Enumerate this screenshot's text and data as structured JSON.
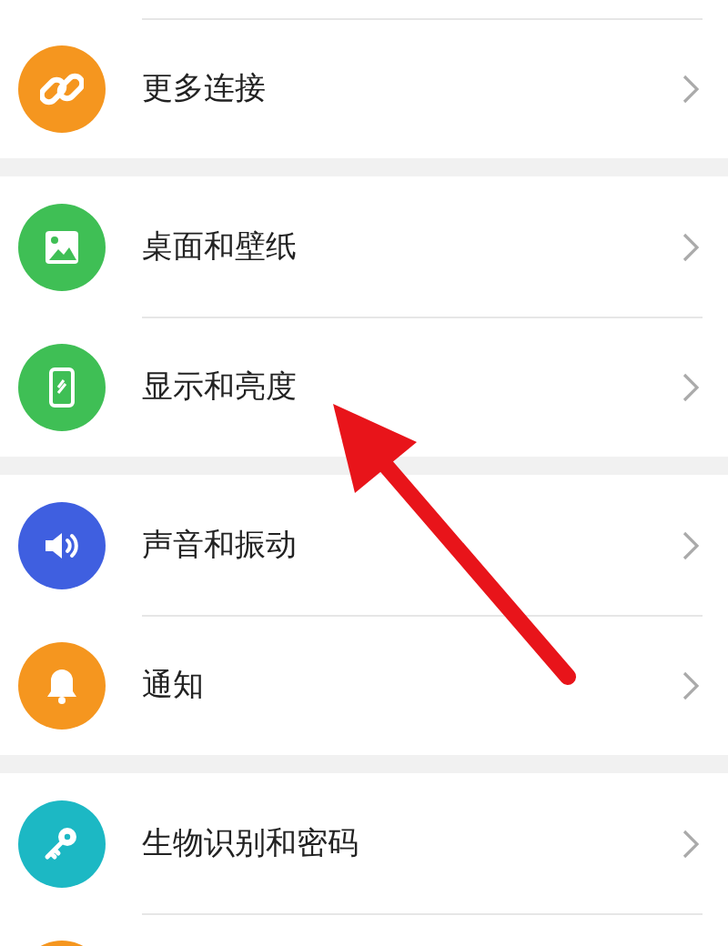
{
  "groups": [
    {
      "items": [
        {
          "kind": "link",
          "label": "更多连接",
          "color": "#f5961f"
        }
      ]
    },
    {
      "items": [
        {
          "kind": "wallpaper",
          "label": "桌面和壁纸",
          "color": "#3fbf55"
        },
        {
          "kind": "display",
          "label": "显示和亮度",
          "color": "#3fbf55"
        }
      ]
    },
    {
      "items": [
        {
          "kind": "sound",
          "label": "声音和振动",
          "color": "#3f5fe0"
        },
        {
          "kind": "bell",
          "label": "通知",
          "color": "#f5961f"
        }
      ]
    },
    {
      "items": [
        {
          "kind": "key",
          "label": "生物识别和密码",
          "color": "#1cb8c4"
        },
        {
          "kind": "other",
          "color": "#f5961f"
        }
      ]
    }
  ],
  "annotation": {
    "kind": "arrow",
    "color": "#e8141a"
  }
}
